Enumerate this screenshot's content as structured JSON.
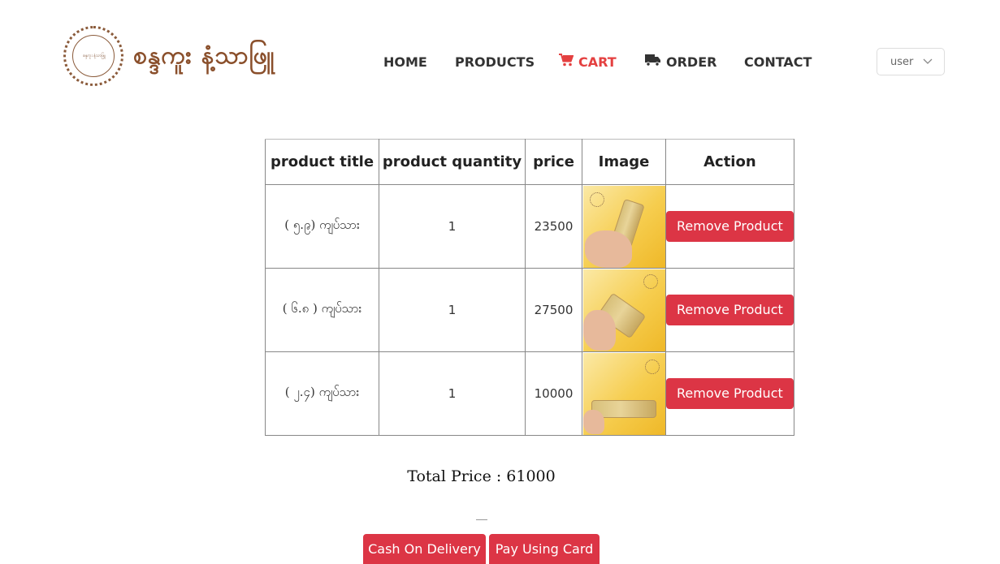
{
  "brand": {
    "name": "စန္ဒကူး နံ့သာဖြူ",
    "mark": "စန္ဒကူး နံ့သာဖြူ"
  },
  "nav": {
    "home": "HOME",
    "products": "PRODUCTS",
    "cart": "CART",
    "order": "ORDER",
    "contact": "CONTACT",
    "active": "cart"
  },
  "user_menu": {
    "selected": "user"
  },
  "cart_table": {
    "headers": [
      "product title",
      "product quantity",
      "price",
      "Image",
      "Action"
    ],
    "rows": [
      {
        "title": "( ၅.၉) ကျပ်သား",
        "quantity": "1",
        "price": "23500",
        "action": "Remove Product"
      },
      {
        "title": "( ၆.၈ ) ကျပ်သား",
        "quantity": "1",
        "price": "27500",
        "action": "Remove Product"
      },
      {
        "title": "( ၂.၄) ကျပ်သား",
        "quantity": "1",
        "price": "10000",
        "action": "Remove Product"
      }
    ]
  },
  "summary": {
    "total_text": "Total Price : 61000"
  },
  "payment": {
    "cod": "Cash On Delivery",
    "card": "Pay Using Card"
  },
  "colors": {
    "accent": "#dc3545",
    "nav_active": "#e44040",
    "brand": "#8a4f2b"
  }
}
